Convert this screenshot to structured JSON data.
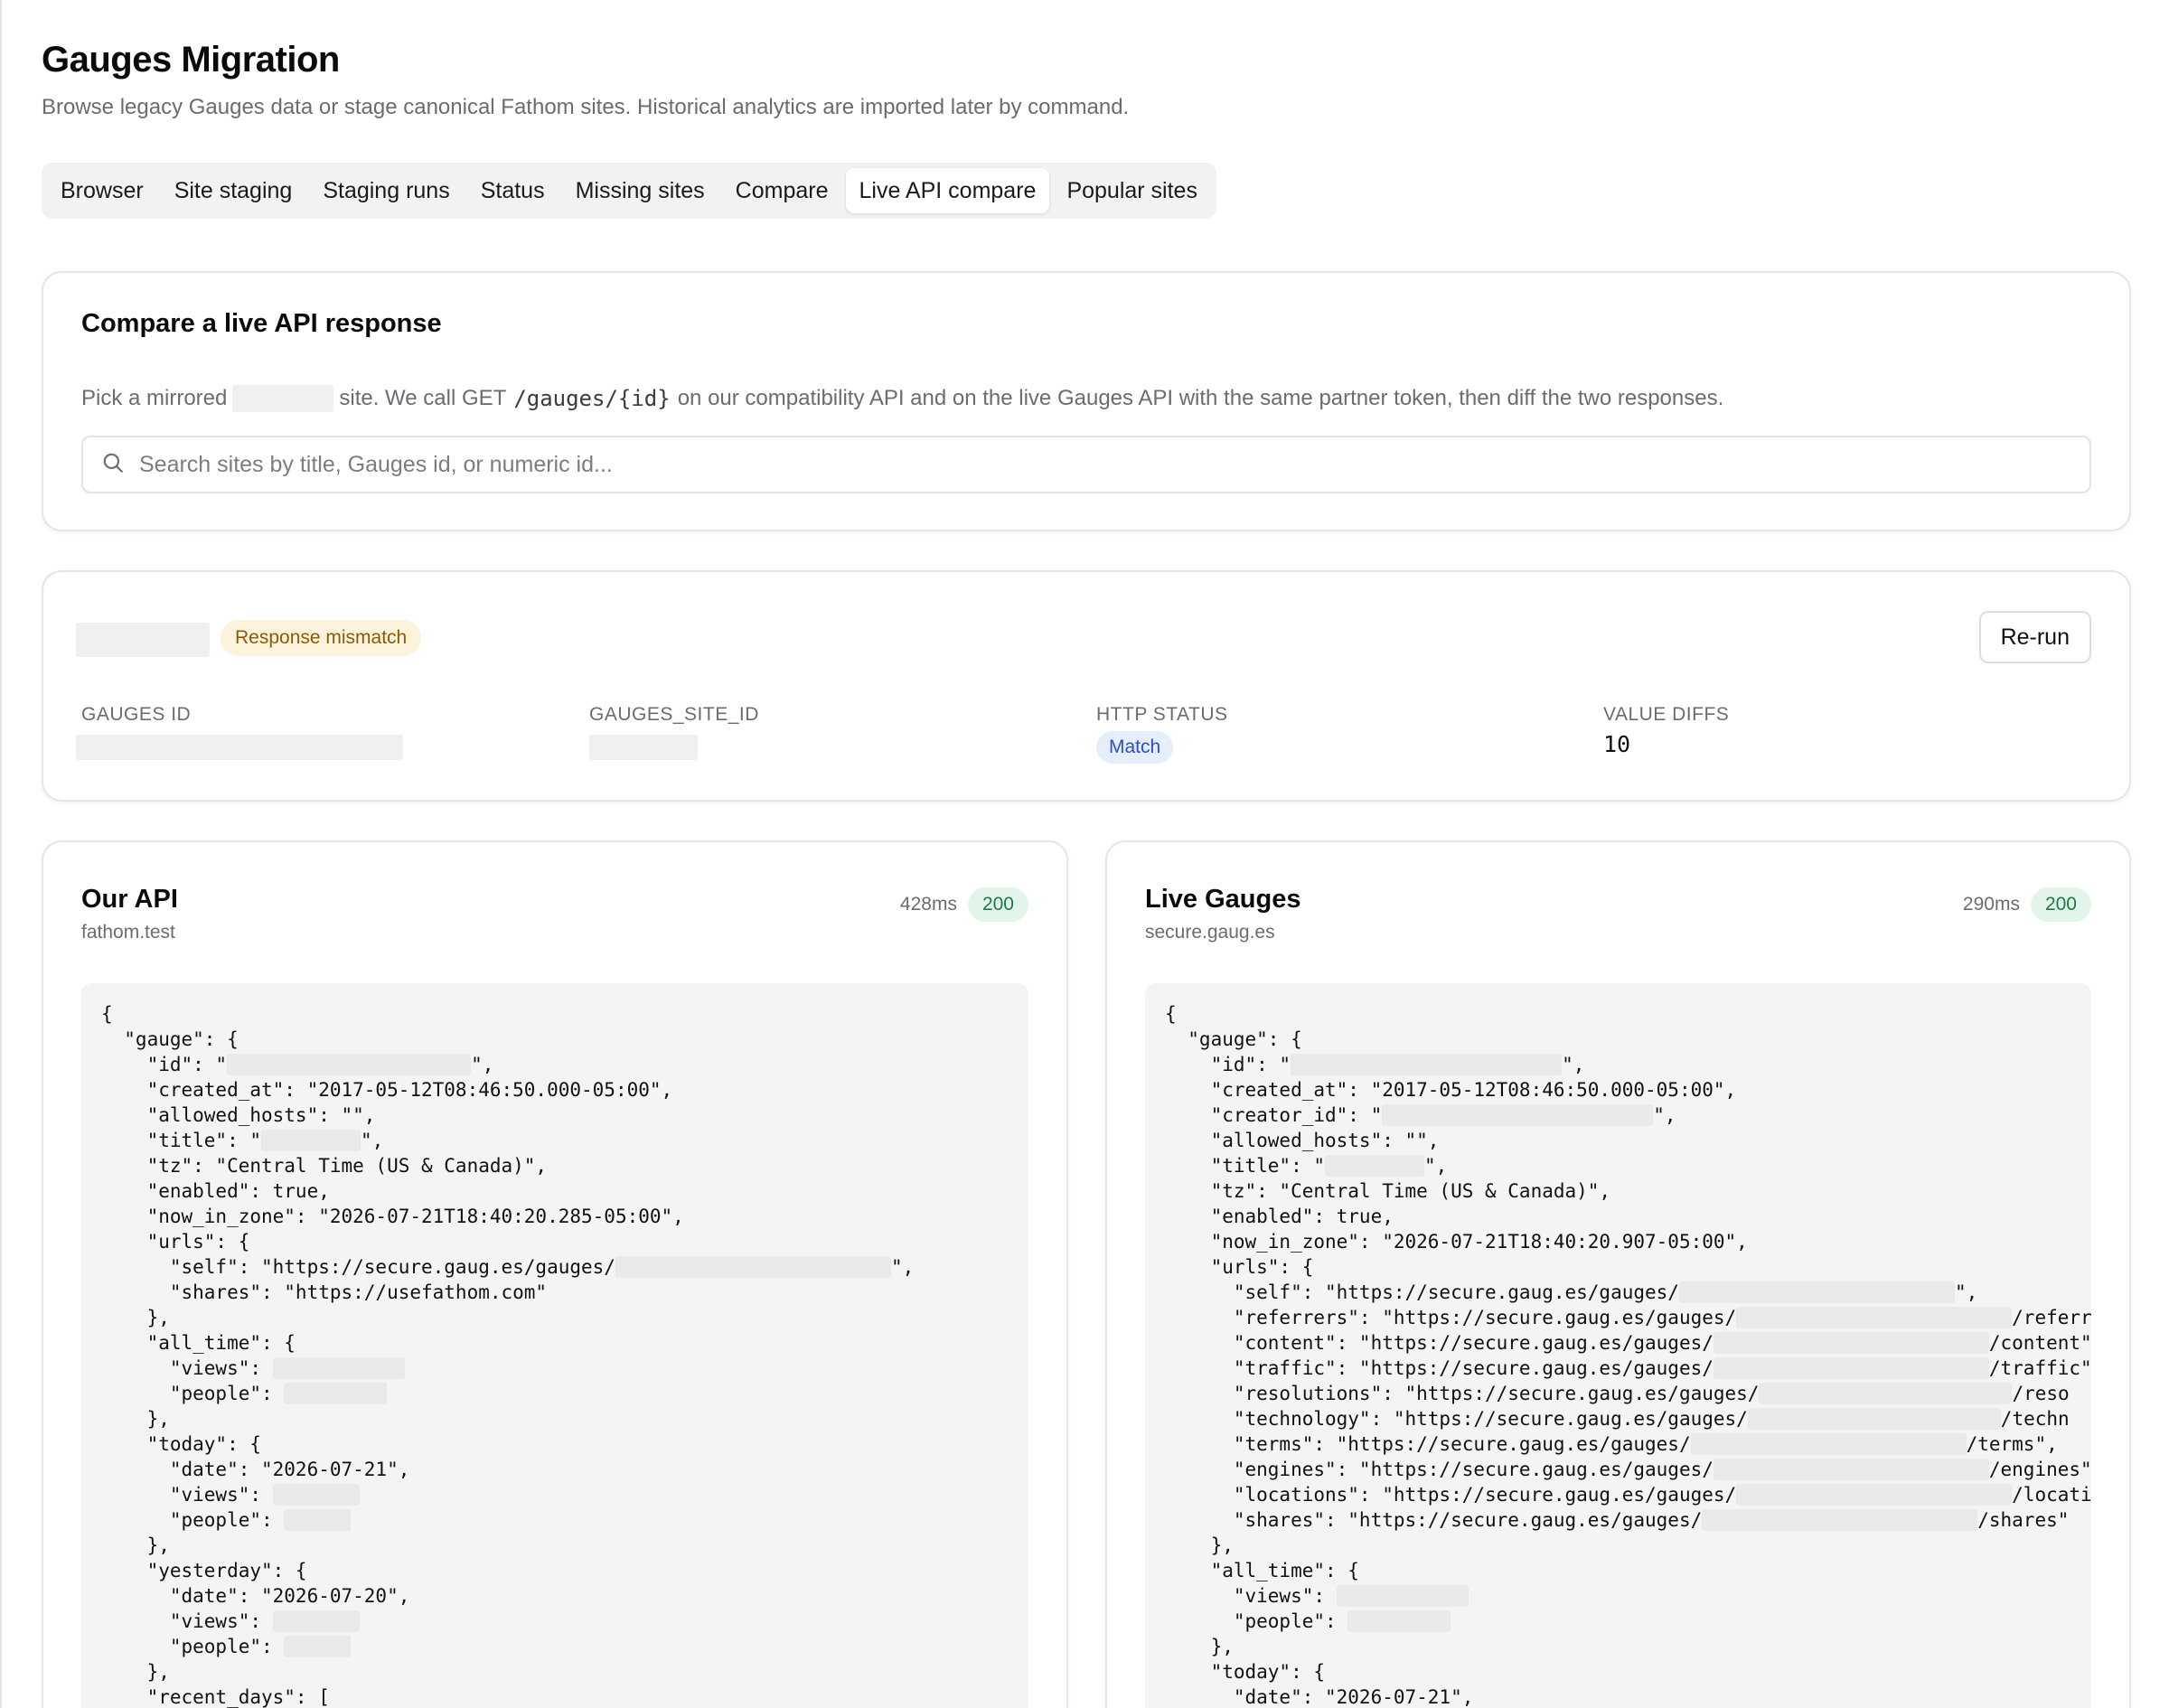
{
  "page": {
    "title": "Gauges Migration",
    "subtitle": "Browse legacy Gauges data or stage canonical Fathom sites. Historical analytics are imported later by command."
  },
  "tabs": [
    {
      "label": "Browser"
    },
    {
      "label": "Site staging"
    },
    {
      "label": "Staging runs"
    },
    {
      "label": "Status"
    },
    {
      "label": "Missing sites"
    },
    {
      "label": "Compare"
    },
    {
      "label": "Live API compare",
      "active": true
    },
    {
      "label": "Popular sites"
    }
  ],
  "compare": {
    "title": "Compare a live API response",
    "desc_part1": "Pick a mirrored",
    "desc_part2": "site. We call GET",
    "desc_code": "/gauges/{id}",
    "desc_part3": "on our compatibility API and on the live Gauges API with the same partner token, then diff the two responses.",
    "search_placeholder": "Search sites by title, Gauges id, or numeric id..."
  },
  "summary": {
    "status_badge": "Response mismatch",
    "rerun_label": "Re-run",
    "gauges_id_label": "GAUGES ID",
    "gauges_site_id_label": "GAUGES_SITE_ID",
    "http_status_label": "HTTP STATUS",
    "http_status_value": "Match",
    "value_diffs_label": "VALUE DIFFS",
    "value_diffs_value": "10"
  },
  "our_api": {
    "title": "Our API",
    "host": "fathom.test",
    "time": "428ms",
    "status_code": "200"
  },
  "live_gauges": {
    "title": "Live Gauges",
    "host": "secure.gaug.es",
    "time": "290ms",
    "status_code": "200"
  },
  "our_code": [
    "{",
    "  \"gauge\": {",
    "    \"id\": \"[[r:270]]\",",
    "    \"created_at\": \"2017-05-12T08:46:50.000-05:00\",",
    "    \"allowed_hosts\": \"\",",
    "    \"title\": \"[[r:110]]\",",
    "    \"tz\": \"Central Time (US & Canada)\",",
    "    \"enabled\": true,",
    "    \"now_in_zone\": \"2026-07-21T18:40:20.285-05:00\",",
    "    \"urls\": {",
    "      \"self\": \"https://secure.gaug.es/gauges/[[r:305]]\",",
    "      \"shares\": \"https://usefathom.com\"",
    "    },",
    "    \"all_time\": {",
    "      \"views\": [[r:146]]",
    "      \"people\": [[r:114]]",
    "    },",
    "    \"today\": {",
    "      \"date\": \"2026-07-21\",",
    "      \"views\": [[r:96]]",
    "      \"people\": [[r:74]]",
    "    },",
    "    \"yesterday\": {",
    "      \"date\": \"2026-07-20\",",
    "      \"views\": [[r:96]]",
    "      \"people\": [[r:74]]",
    "    },",
    "    \"recent_days\": ["
  ],
  "live_code": [
    "{",
    "  \"gauge\": {",
    "    \"id\": \"[[r:300]]\",",
    "    \"created_at\": \"2017-05-12T08:46:50.000-05:00\",",
    "    \"creator_id\": \"[[r:300]]\",",
    "    \"allowed_hosts\": \"\",",
    "    \"title\": \"[[r:110]]\",",
    "    \"tz\": \"Central Time (US & Canada)\",",
    "    \"enabled\": true,",
    "    \"now_in_zone\": \"2026-07-21T18:40:20.907-05:00\",",
    "    \"urls\": {",
    "      \"self\": \"https://secure.gaug.es/gauges/[[r:305]]\",",
    "      \"referrers\": \"https://secure.gaug.es/gauges/[[r:305]]/referr",
    "      \"content\": \"https://secure.gaug.es/gauges/[[r:305]]/content\"",
    "      \"traffic\": \"https://secure.gaug.es/gauges/[[r:305]]/traffic\"",
    "      \"resolutions\": \"https://secure.gaug.es/gauges/[[r:280]]/reso",
    "      \"technology\": \"https://secure.gaug.es/gauges/[[r:280]]/techn",
    "      \"terms\": \"https://secure.gaug.es/gauges/[[r:305]]/terms\",",
    "      \"engines\": \"https://secure.gaug.es/gauges/[[r:305]]/engines\"",
    "      \"locations\": \"https://secure.gaug.es/gauges/[[r:305]]/locati",
    "      \"shares\": \"https://secure.gaug.es/gauges/[[r:305]]/shares\"",
    "    },",
    "    \"all_time\": {",
    "      \"views\": [[r:146]]",
    "      \"people\": [[r:114]]",
    "    },",
    "    \"today\": {",
    "      \"date\": \"2026-07-21\","
  ],
  "icons": {
    "search": "search-icon"
  },
  "colors": {
    "mismatch_bg": "#fdf3dc",
    "mismatch_text": "#8a5a06",
    "match_bg": "#e6edfd",
    "match_text": "#2a4fc7",
    "ok_bg": "#e3f5ea",
    "ok_text": "#1c7a44"
  }
}
